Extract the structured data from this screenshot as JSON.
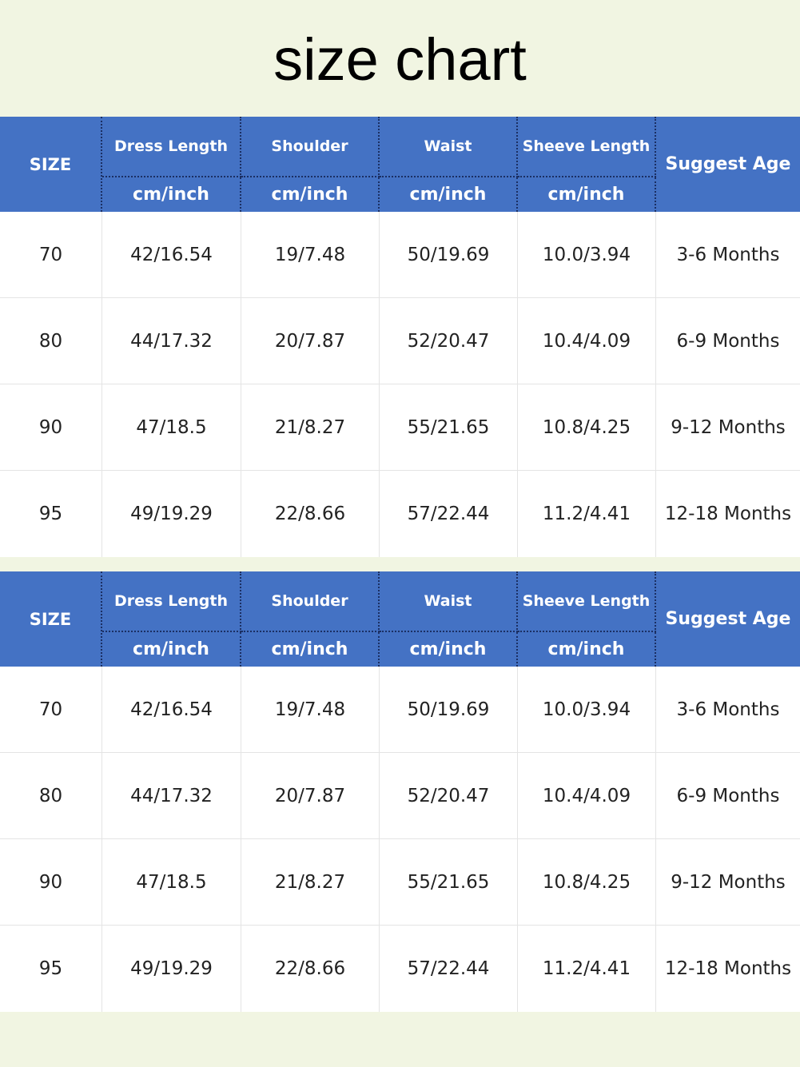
{
  "title": "size chart",
  "header": {
    "size": "SIZE",
    "columns": [
      "Dress Length",
      "Shoulder",
      "Waist",
      "Sheeve Length"
    ],
    "unit": "cm/inch",
    "age": "Suggest Age"
  },
  "rows": [
    [
      "70",
      "42/16.54",
      "19/7.48",
      "50/19.69",
      "10.0/3.94",
      "3-6 Months"
    ],
    [
      "80",
      "44/17.32",
      "20/7.87",
      "52/20.47",
      "10.4/4.09",
      "6-9 Months"
    ],
    [
      "90",
      "47/18.5",
      "21/8.27",
      "55/21.65",
      "10.8/4.25",
      "9-12 Months"
    ],
    [
      "95",
      "49/19.29",
      "22/8.66",
      "57/22.44",
      "11.2/4.41",
      "12-18 Months"
    ]
  ],
  "colors": {
    "header_bg": "#4472c4",
    "page_bg": "#f1f5e2"
  }
}
